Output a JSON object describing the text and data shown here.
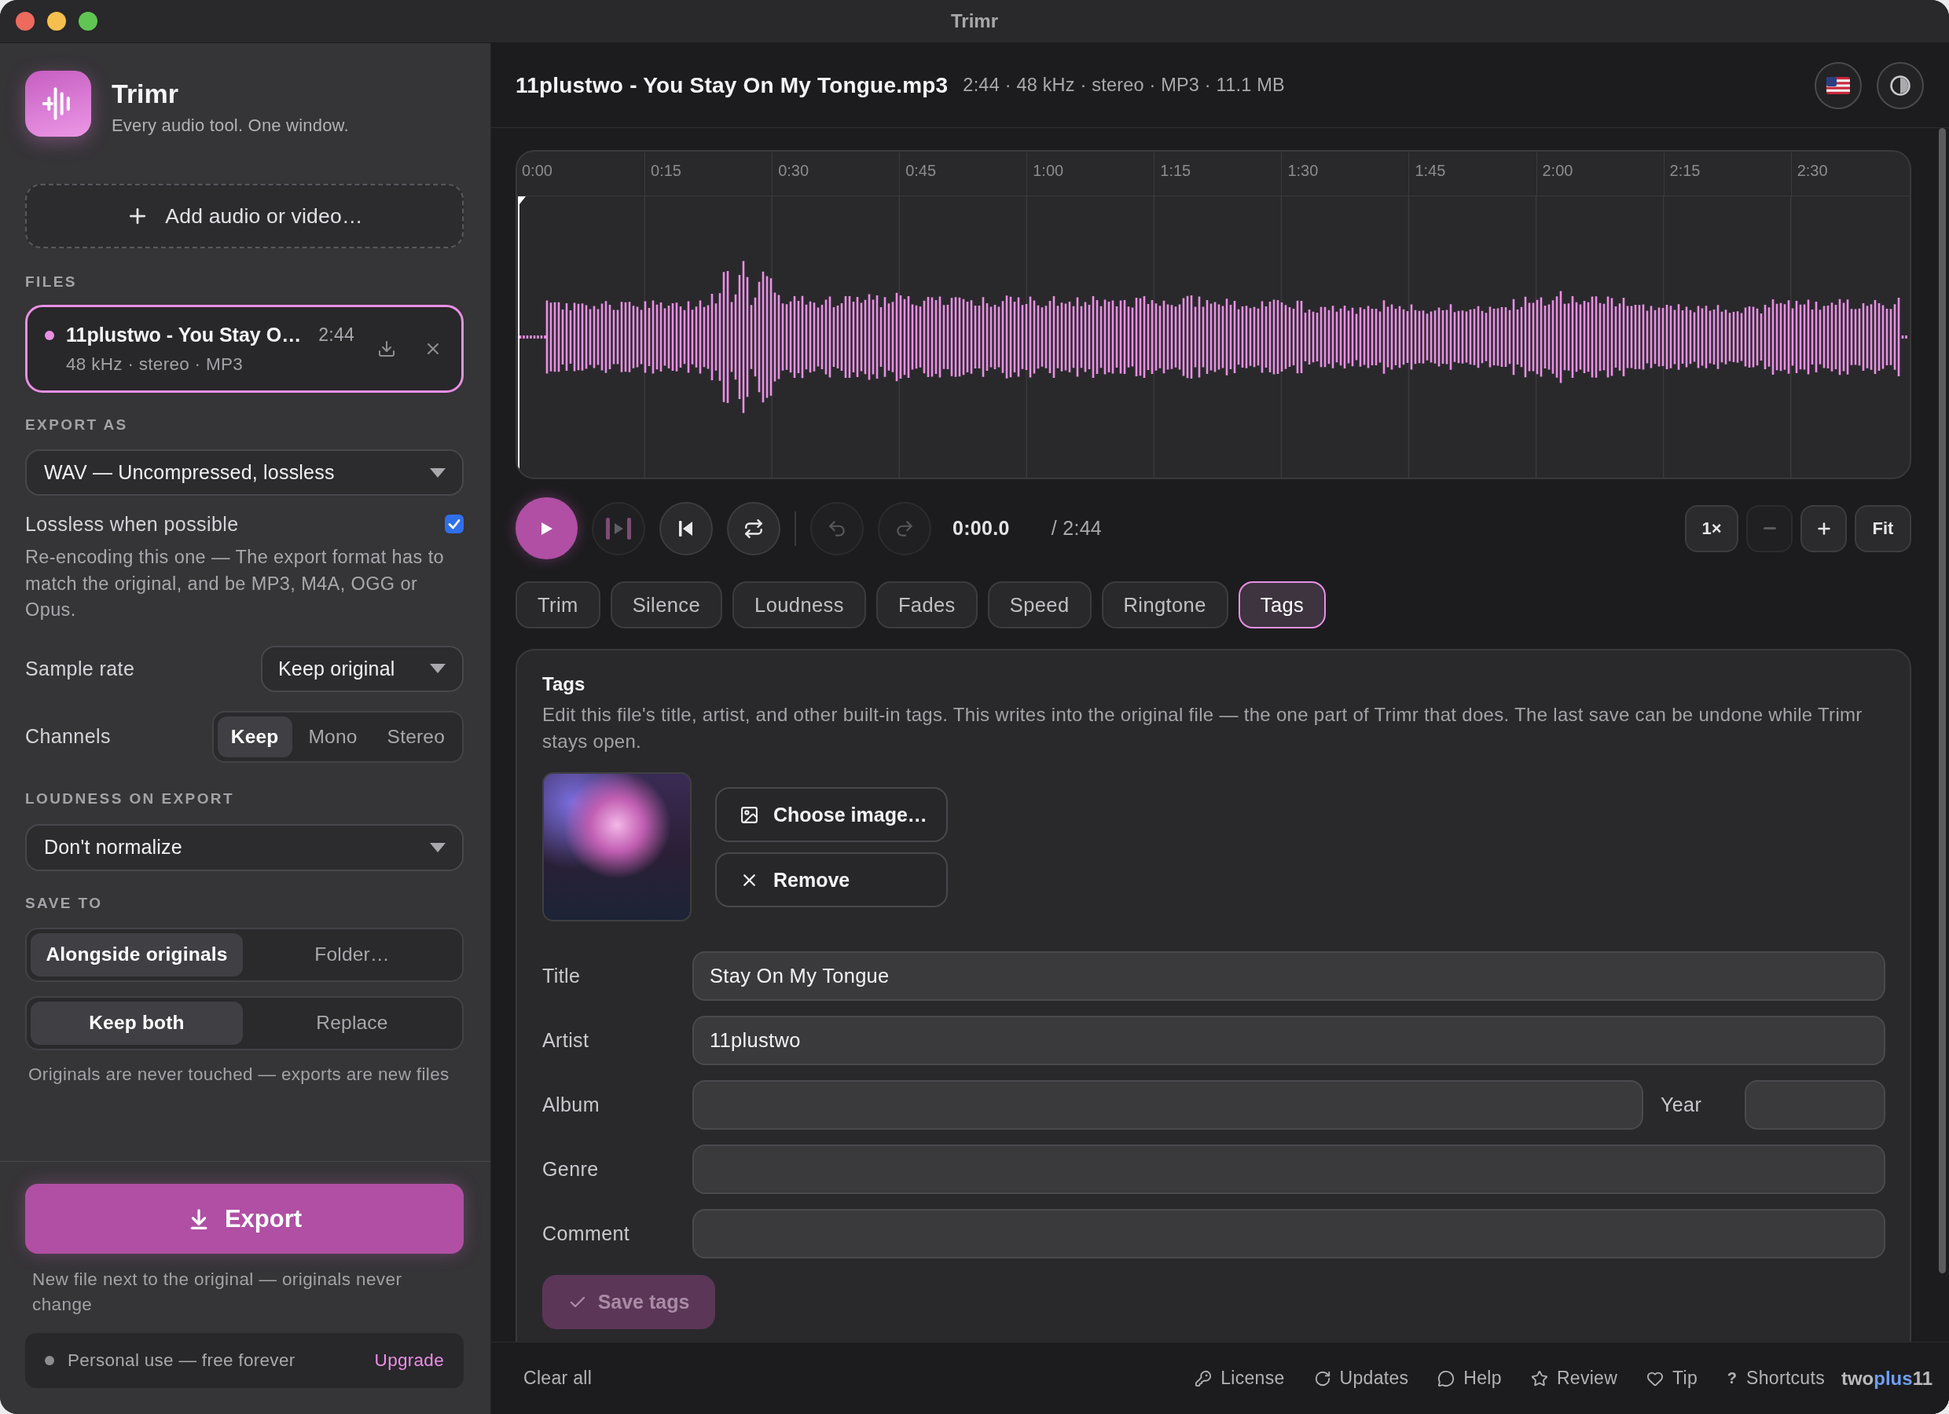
{
  "window": {
    "title": "Trimr"
  },
  "sidebar": {
    "app": {
      "name": "Trimr",
      "tagline": "Every audio tool. One window."
    },
    "add_button": "Add audio or video…",
    "files": {
      "heading": "FILES",
      "items": [
        {
          "name": "11plustwo - You Stay O…",
          "duration": "2:44",
          "meta": "48 kHz · stereo · MP3",
          "selected": true
        }
      ]
    },
    "export_as": {
      "heading": "EXPORT AS",
      "value": "WAV — Uncompressed, lossless"
    },
    "lossless": {
      "label": "Lossless when possible",
      "checked": true
    },
    "note": "Re-encoding this one — The export format has to match the original, and be MP3, M4A, OGG or Opus.",
    "sample_rate": {
      "label": "Sample rate",
      "value": "Keep original"
    },
    "channels": {
      "label": "Channels",
      "options": [
        {
          "label": "Keep",
          "selected": true
        },
        {
          "label": "Mono",
          "selected": false
        },
        {
          "label": "Stereo",
          "selected": false
        }
      ]
    },
    "loudness": {
      "heading": "LOUDNESS ON EXPORT",
      "value": "Don't normalize"
    },
    "save_to": {
      "heading": "SAVE TO",
      "location": [
        {
          "label": "Alongside originals",
          "selected": true
        },
        {
          "label": "Folder…",
          "selected": false
        }
      ],
      "existing": [
        {
          "label": "Keep both",
          "selected": true
        },
        {
          "label": "Replace",
          "selected": false
        }
      ],
      "note": "Originals are never touched — exports are new files"
    },
    "export": {
      "label": "Export",
      "note": "New file next to the original — originals never change"
    },
    "plan": {
      "text": "Personal use — free forever",
      "action": "Upgrade"
    }
  },
  "header": {
    "filename": "11plustwo - You Stay On My Tongue.mp3",
    "meta": "2:44 · 48 kHz · stereo · MP3 · 11.1 MB"
  },
  "timeline": {
    "ticks": [
      "0:00",
      "0:15",
      "0:30",
      "0:45",
      "1:00",
      "1:15",
      "1:30",
      "1:45",
      "2:00",
      "2:15",
      "2:30"
    ],
    "playhead": {
      "level": 0
    }
  },
  "transport": {
    "playback": [
      {
        "kind": "play",
        "disabled": false
      },
      {
        "kind": "play-selection",
        "disabled": true
      },
      {
        "kind": "to-start",
        "disabled": false
      },
      {
        "kind": "loop",
        "disabled": false
      }
    ],
    "history": [
      {
        "kind": "undo",
        "disabled": true
      },
      {
        "kind": "redo",
        "disabled": true
      }
    ],
    "time": "0:00.0",
    "duration": "/ 2:44",
    "zoom": [
      {
        "kind": "speed",
        "label": "1×",
        "disabled": false
      },
      {
        "kind": "zoom-out",
        "disabled": true
      },
      {
        "kind": "zoom-in",
        "disabled": false
      },
      {
        "kind": "fit",
        "label": "Fit",
        "disabled": false
      }
    ]
  },
  "tabs": [
    {
      "label": "Trim",
      "selected": false
    },
    {
      "label": "Silence",
      "selected": false
    },
    {
      "label": "Loudness",
      "selected": false
    },
    {
      "label": "Fades",
      "selected": false
    },
    {
      "label": "Speed",
      "selected": false
    },
    {
      "label": "Ringtone",
      "selected": false
    },
    {
      "label": "Tags",
      "selected": true
    }
  ],
  "tags_panel": {
    "title": "Tags",
    "description": "Edit this file's title, artist, and other built-in tags. This writes into the original file — the one part of Trimr that does. The last save can be undone while Trimr stays open.",
    "buttons": [
      {
        "kind": "choose",
        "label": "Choose image…"
      },
      {
        "kind": "remove",
        "label": "Remove"
      }
    ],
    "fields": [
      {
        "label": "Title",
        "value": "Stay On My Tongue"
      },
      {
        "label": "Artist",
        "value": "11plustwo"
      },
      {
        "label": "Album",
        "extra": {
          "label": "Year"
        }
      },
      {
        "label": "Genre"
      },
      {
        "label": "Comment"
      }
    ],
    "save": {
      "label": "Save tags",
      "disabled": true
    }
  },
  "footer": {
    "clear": "Clear all",
    "links": [
      {
        "kind": "license",
        "label": "License"
      },
      {
        "kind": "updates",
        "label": "Updates"
      },
      {
        "kind": "help",
        "label": "Help"
      },
      {
        "kind": "review",
        "label": "Review"
      },
      {
        "kind": "tip",
        "label": "Tip"
      },
      {
        "kind": "shortcuts",
        "label": "Shortcuts",
        "glyph": "?"
      }
    ],
    "brand": [
      {
        "text": "two",
        "accent": false
      },
      {
        "text": "plus",
        "accent": true
      },
      {
        "text": "11",
        "accent": false
      }
    ]
  }
}
